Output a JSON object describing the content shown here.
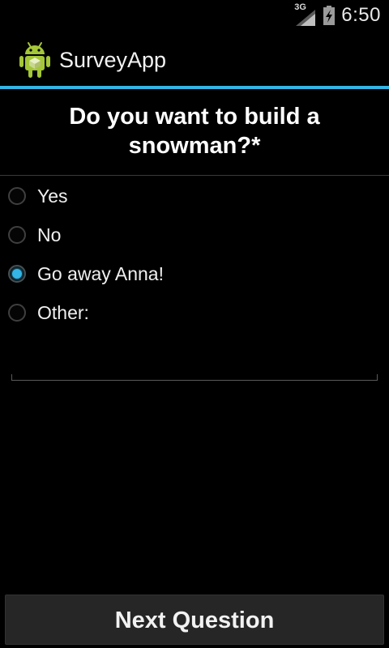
{
  "status_bar": {
    "network_type": "3G",
    "time": "6:50",
    "icons": [
      "signal-icon",
      "battery-icon"
    ]
  },
  "action_bar": {
    "title": "SurveyApp",
    "icon": "android-icon"
  },
  "question": {
    "text": "Do you want to build a snowman?*"
  },
  "options": [
    {
      "label": "Yes",
      "selected": false
    },
    {
      "label": "No",
      "selected": false
    },
    {
      "label": "Go away Anna!",
      "selected": true
    },
    {
      "label": "Other:",
      "selected": false
    }
  ],
  "other_input": {
    "value": ""
  },
  "footer": {
    "next_label": "Next Question"
  },
  "colors": {
    "accent": "#33b5e5",
    "background": "#000000",
    "button": "#262626",
    "android_green": "#a4c639"
  }
}
